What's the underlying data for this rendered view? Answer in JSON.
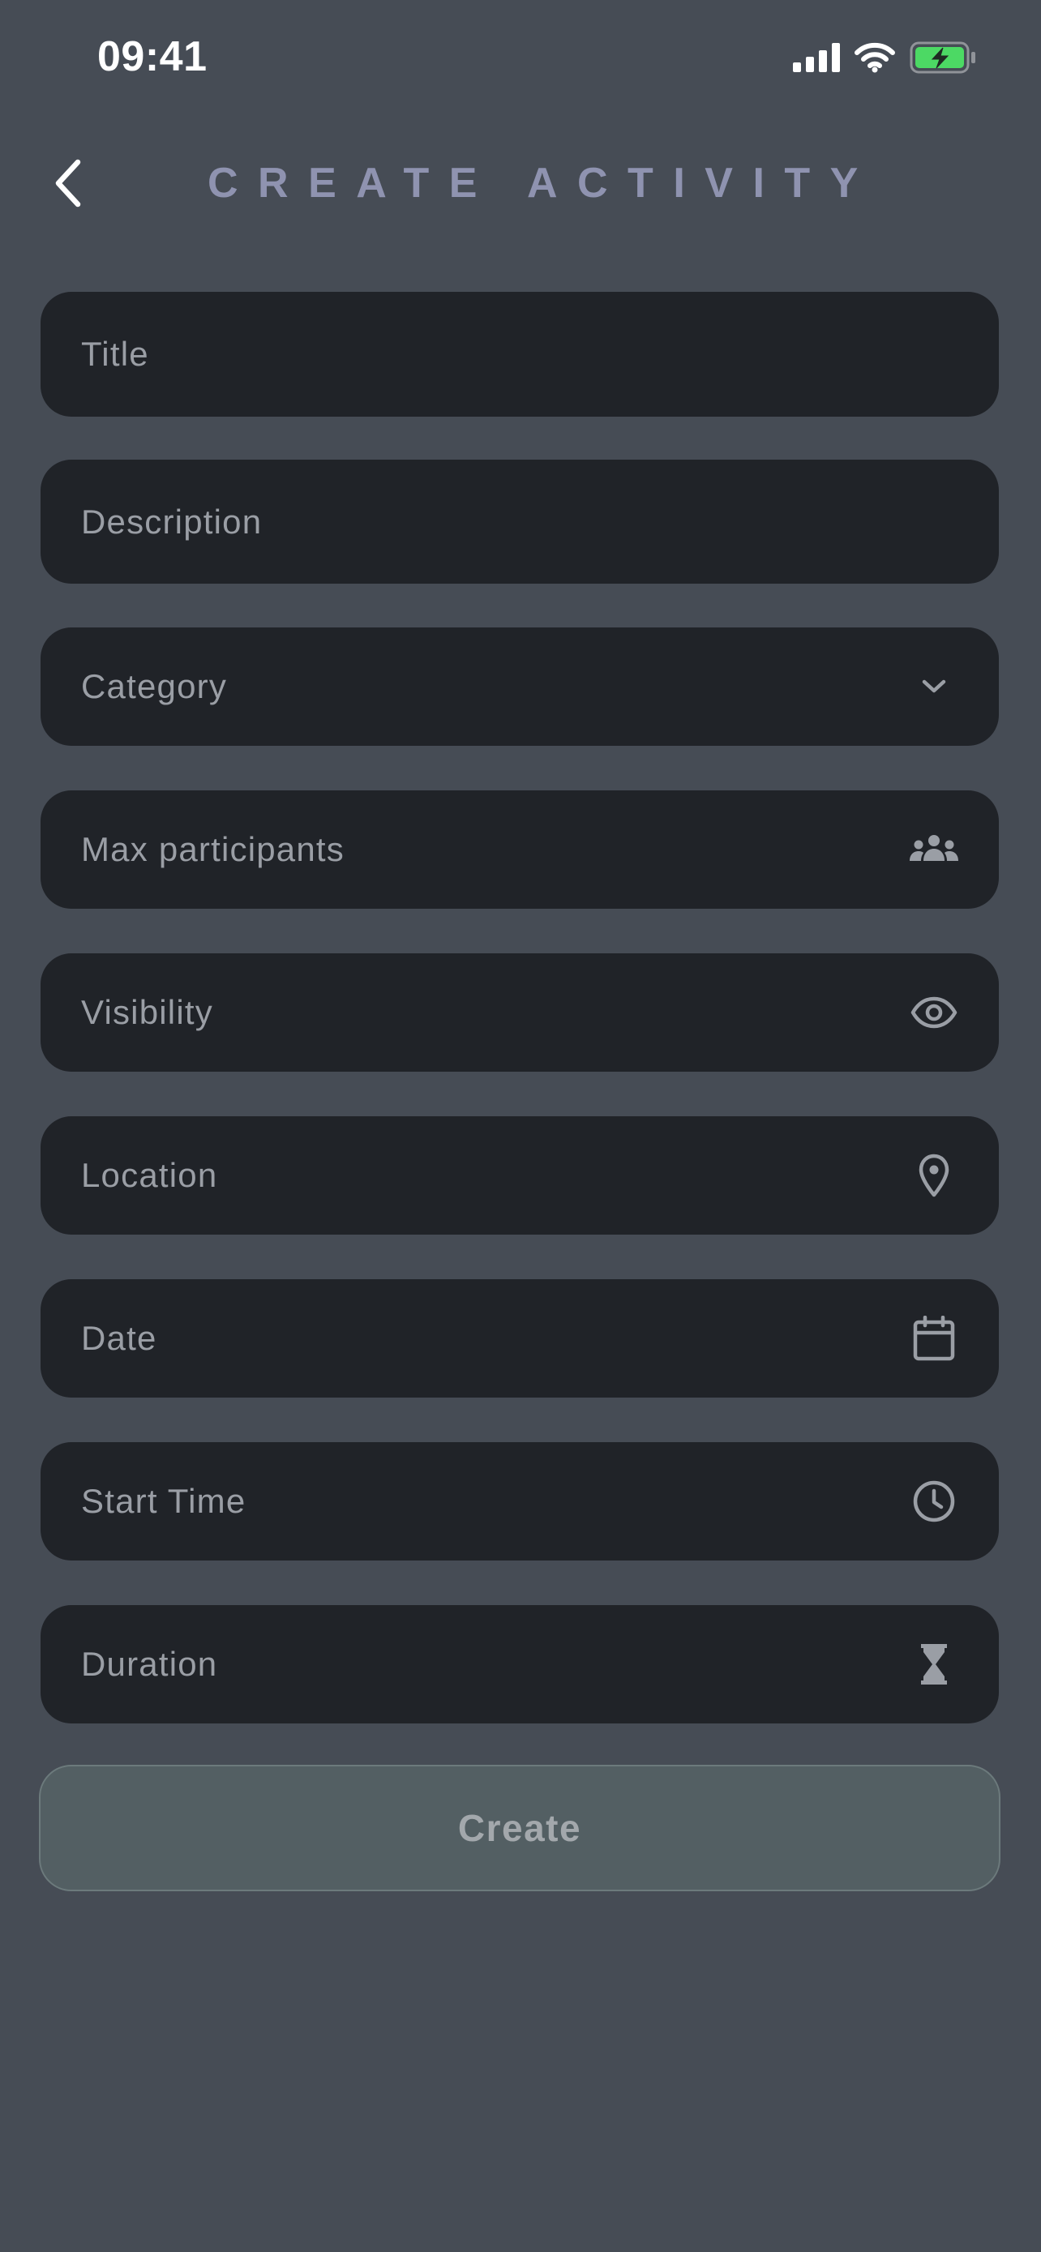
{
  "status_bar": {
    "time": "09:41"
  },
  "header": {
    "title": "CREATE ACTIVITY",
    "back_icon": "chevron-left-icon"
  },
  "form": {
    "fields": [
      {
        "placeholder": "Title",
        "icon": null
      },
      {
        "placeholder": "Description",
        "icon": null
      },
      {
        "placeholder": "Category",
        "icon": "chevron-down-icon"
      },
      {
        "placeholder": "Max participants",
        "icon": "people-icon"
      },
      {
        "placeholder": "Visibility",
        "icon": "eye-icon"
      },
      {
        "placeholder": "Location",
        "icon": "map-pin-icon"
      },
      {
        "placeholder": "Date",
        "icon": "calendar-icon"
      },
      {
        "placeholder": "Start Time",
        "icon": "clock-icon"
      },
      {
        "placeholder": "Duration",
        "icon": "hourglass-icon"
      }
    ],
    "submit_label": "Create"
  },
  "colors": {
    "background": "#464c55",
    "field_background": "#202328",
    "title": "#8f93b0",
    "placeholder": "#9a9ea5",
    "button_background": "#535f63",
    "battery_green": "#4cd964"
  }
}
